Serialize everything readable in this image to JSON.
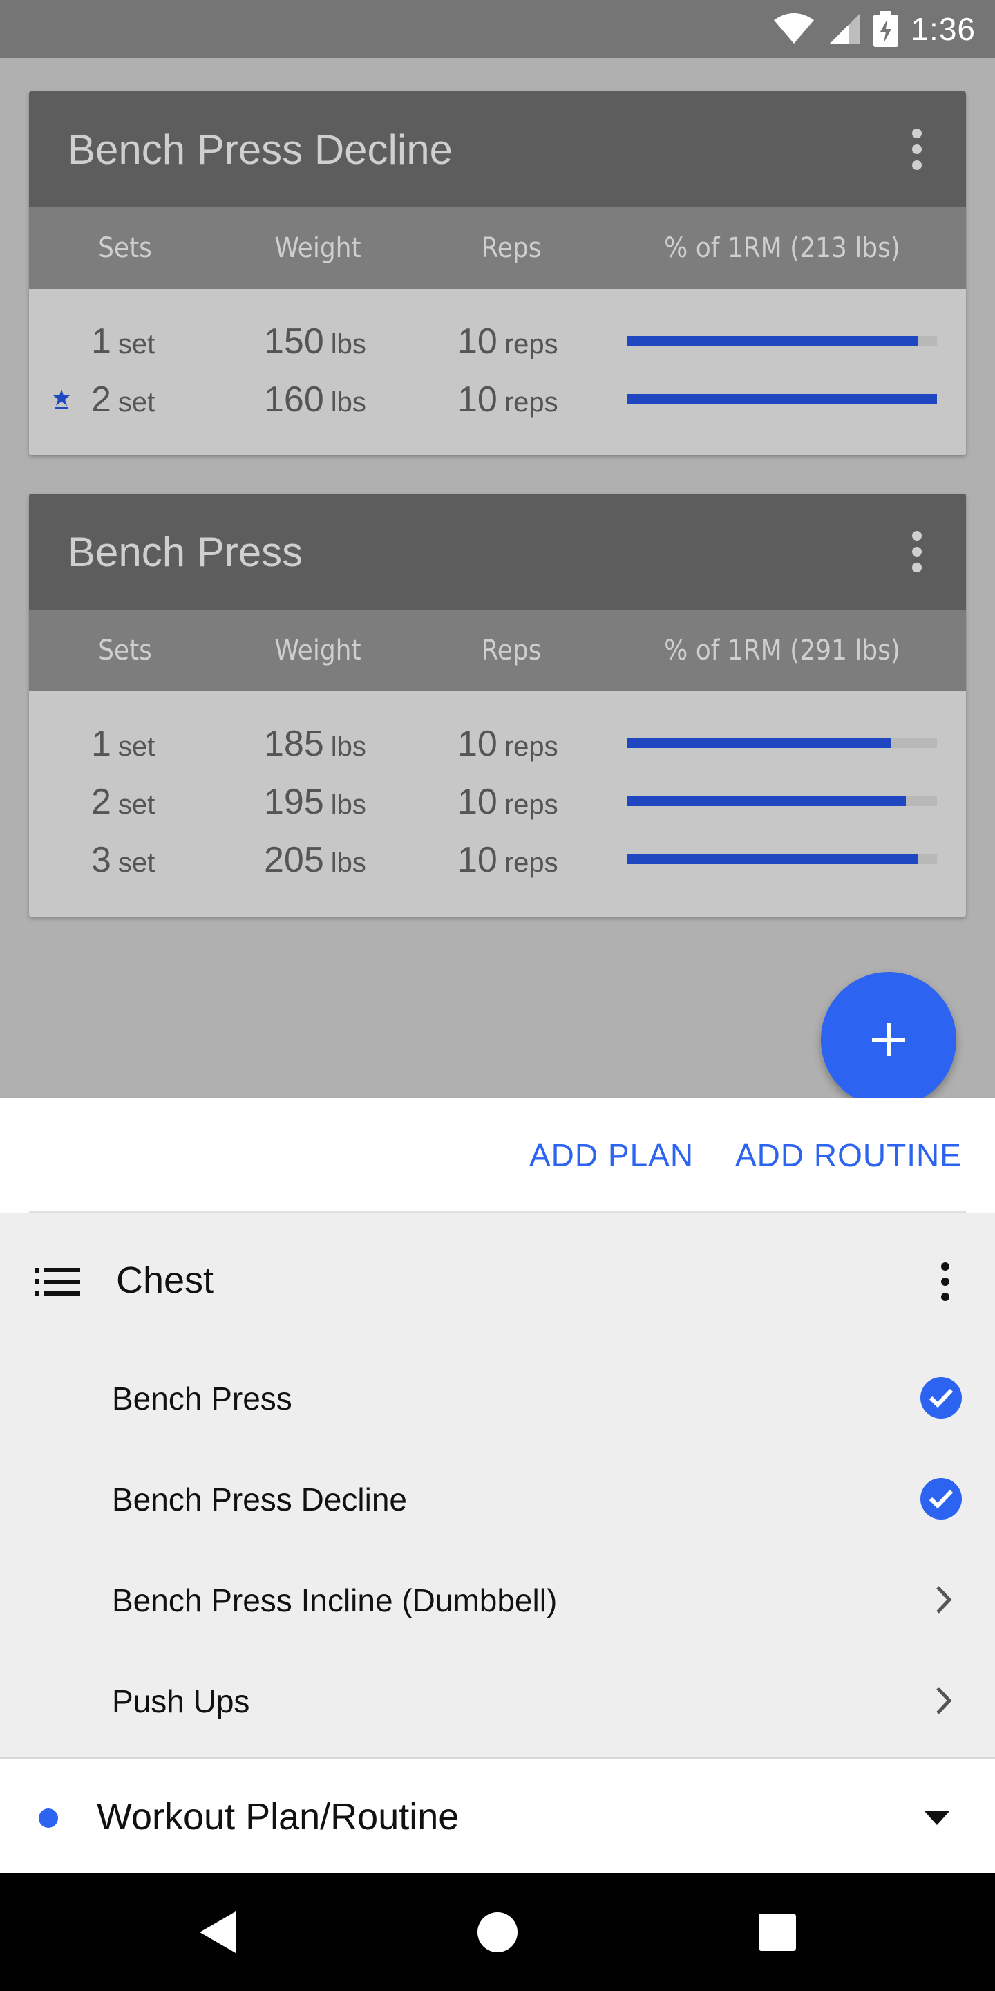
{
  "status_bar": {
    "time": "1:36"
  },
  "cards": [
    {
      "title": "Bench Press Decline",
      "columns": [
        "Sets",
        "Weight",
        "Reps",
        "% of 1RM (213 lbs)"
      ],
      "rows": [
        {
          "set": "1",
          "set_unit": "set",
          "weight": "150",
          "weight_unit": "lbs",
          "reps": "10",
          "reps_unit": "reps",
          "percent": 0.94,
          "starred": false
        },
        {
          "set": "2",
          "set_unit": "set",
          "weight": "160",
          "weight_unit": "lbs",
          "reps": "10",
          "reps_unit": "reps",
          "percent": 1.0,
          "starred": true
        }
      ]
    },
    {
      "title": "Bench Press",
      "columns": [
        "Sets",
        "Weight",
        "Reps",
        "% of 1RM (291 lbs)"
      ],
      "rows": [
        {
          "set": "1",
          "set_unit": "set",
          "weight": "185",
          "weight_unit": "lbs",
          "reps": "10",
          "reps_unit": "reps",
          "percent": 0.85,
          "starred": false
        },
        {
          "set": "2",
          "set_unit": "set",
          "weight": "195",
          "weight_unit": "lbs",
          "reps": "10",
          "reps_unit": "reps",
          "percent": 0.9,
          "starred": false
        },
        {
          "set": "3",
          "set_unit": "set",
          "weight": "205",
          "weight_unit": "lbs",
          "reps": "10",
          "reps_unit": "reps",
          "percent": 0.94,
          "starred": false
        }
      ]
    }
  ],
  "fab": {
    "icon": "plus-icon"
  },
  "actions": {
    "add_plan": "ADD PLAN",
    "add_routine": "ADD ROUTINE"
  },
  "group": {
    "title": "Chest",
    "items": [
      {
        "label": "Bench Press",
        "state": "checked"
      },
      {
        "label": "Bench Press Decline",
        "state": "checked"
      },
      {
        "label": "Bench Press Incline (Dumbbell)",
        "state": "chevron"
      },
      {
        "label": "Push Ups",
        "state": "chevron"
      }
    ]
  },
  "bottom": {
    "title": "Workout Plan/Routine"
  },
  "colors": {
    "accent": "#2c63f0",
    "bar": "#2047c2",
    "card_header": "#5d5d5d",
    "column_header": "#7d7d7d"
  }
}
